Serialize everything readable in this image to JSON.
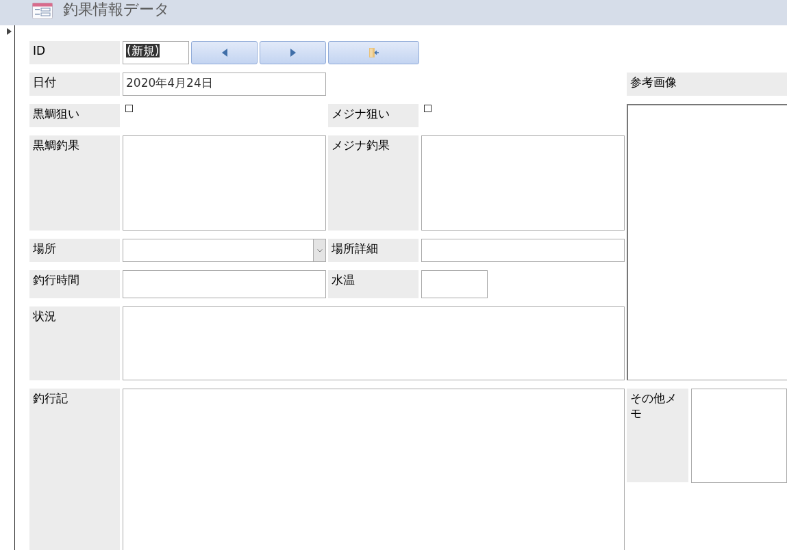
{
  "form": {
    "title": "釣果情報データ"
  },
  "record_selector": {
    "current": true
  },
  "id_row": {
    "label": "ID",
    "value": "(新規)",
    "selected": true,
    "buttons": [
      {
        "kind": "previous"
      },
      {
        "kind": "next"
      },
      {
        "kind": "close"
      }
    ]
  },
  "date": {
    "label": "日付",
    "value": "2020年4月24日"
  },
  "reference_image": {
    "label": "参考画像"
  },
  "kurodai_target": {
    "label": "黒鯛狙い",
    "checked": false
  },
  "mejina_target": {
    "label": "メジナ狙い",
    "checked": false
  },
  "kurodai_result": {
    "label": "黒鯛釣果"
  },
  "mejina_result": {
    "label": "メジナ釣果"
  },
  "place": {
    "label": "場所"
  },
  "place_detail": {
    "label": "場所詳細"
  },
  "fishing_time": {
    "label": "釣行時間"
  },
  "water_temp": {
    "label": "水温"
  },
  "conditions": {
    "label": "状況"
  },
  "journal": {
    "label": "釣行記"
  },
  "other_memo": {
    "label": "その他メモ"
  }
}
